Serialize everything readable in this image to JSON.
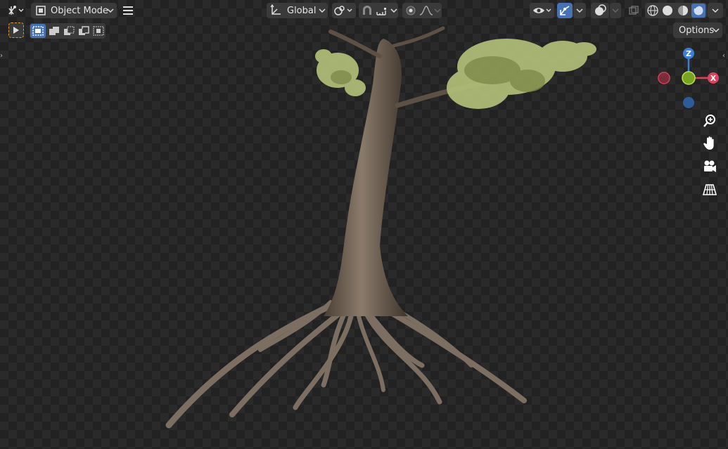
{
  "header": {
    "mode_label": "Object Mode",
    "orientation_label": "Global"
  },
  "options": {
    "label": "Options"
  },
  "gizmo": {
    "z_label": "Z",
    "x_label": "X",
    "colors": {
      "x": "#e0415a",
      "y": "#8bbb27",
      "z": "#3d7fd6",
      "neg_x": "#b3354a",
      "neg_z": "#2d5d99"
    }
  },
  "icons": {
    "editor_type": "grid-transform-icon",
    "mode": "object-mode-icon",
    "menu": "hamburger-menu-icon",
    "orientation": "transform-orientation-icon",
    "pivot": "pivot-point-icon",
    "snap": "snap-magnet-icon",
    "snap_target": "snap-increment-icon",
    "proportional": "proportional-edit-icon",
    "falloff": "falloff-curve-icon",
    "visibility": "eye-visibility-icon",
    "gizmo_toggle": "gizmo-toggle-icon",
    "overlay": "overlay-icon",
    "xray": "xray-icon",
    "wireframe": "wireframe-shading-icon",
    "solid": "solid-shading-icon",
    "material": "material-preview-icon",
    "rendered": "rendered-shading-icon",
    "zoom": "zoom-icon",
    "pan": "hand-pan-icon",
    "camera": "camera-view-icon",
    "perspective": "perspective-grid-icon"
  }
}
